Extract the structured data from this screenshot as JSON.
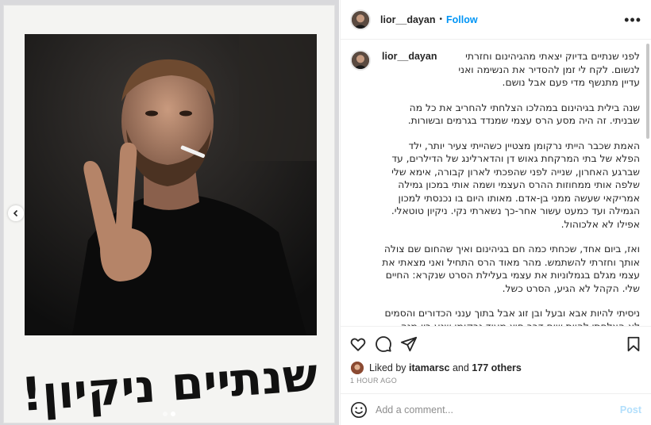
{
  "post": {
    "username": "lior__dayan",
    "separator": "•",
    "follow_label": "Follow",
    "more_label": "•••"
  },
  "caption": {
    "username": "lior__dayan",
    "first_line": "לפני שנתיים בדיוק יצאתי מהגיהינום וחזרתי לנשום. לקח לי זמן להסדיר את הנשימה ואני עדיין מתנשף מדי פעם אבל נושם.",
    "paragraphs": [
      "שנה בילית בגיהינום במהלכו הצלחתי להחריב את כל מה שבניתי. זה היה מסע הרס עצמי שמנדד בגרמים ובשורות.",
      "האמת שכבר הייתי נרקומן מצטיין כשהייתי צעיר יותר, ילד הפלא של בתי המרקחת גאוש דן והדארלינג של הדילרים, עד שברגע האחרון, שנייה לפני שהפכתי לארון קבורה, אימא שלי שלפה אותי ממחוזות ההרס העצמי ושמה אותי במכון גמילה אמריקאי שעשה ממני בן-אדם. מאותו היום בו נכנסתי למכון הגמילה ועד כמעט עשור אחר-כך נשארתי נקי. ניקיון טוטאלי. אפילו לא אלכוהול.",
      "ואז, ביום אחד, שכחתי כמה חם בגיהינום ואיך שהחום שם צולה אותך וחזרתי להשתמש. מהר מאוד הרס התחיל ואני מצאתי את עצמי מגלם בגמלוניות את עצמי בעלילת הסרט שנקרא: החיים שלי. הקהל לא הגיע, הסרט כשל.",
      "ניסיתי להיות אבא ובעל ובן זוג אבל בתוך ענני הכדורים והסמים לא הצלחתי להיות שום דבר חוץ מעוד נרקומן שנע בין מנה למנה, בין כדור לכדור.\nכשלתי בכל התפקידים כישלון מפואר בלי שיהיו לי חלומות במגירה. אין לך לא חלומות ולא מגירות כשאתה עבד בממלכת הג'אנק וכל"
    ]
  },
  "handwriting_text": "שנתיים ניקיון!",
  "actions": {
    "like": "heart-icon",
    "comment": "comment-icon",
    "share": "share-icon",
    "save": "bookmark-icon"
  },
  "likes": {
    "prefix": "Liked by",
    "user": "itamarsc",
    "connector": "and",
    "others": "177 others"
  },
  "timestamp": "1 HOUR AGO",
  "comment": {
    "placeholder": "Add a comment...",
    "post_label": "Post"
  },
  "carousel": {
    "current": 1,
    "total": 2
  },
  "colors": {
    "accent": "#0095f6",
    "post_disabled": "#b2dffc",
    "muted": "#8e8e8e",
    "border": "#efefef"
  }
}
